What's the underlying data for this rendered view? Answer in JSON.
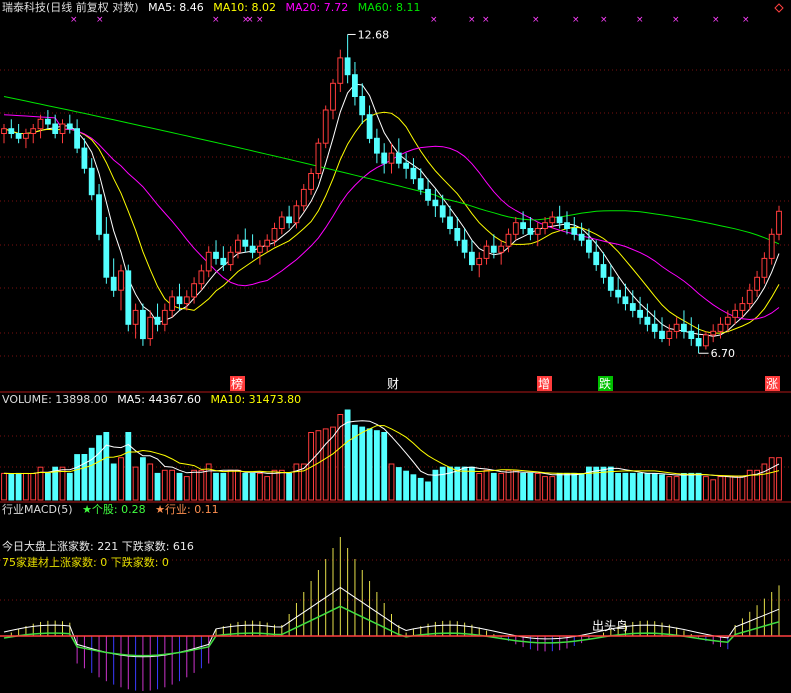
{
  "colors": {
    "up": "#ff3c3c",
    "down": "#54ffff",
    "ma5": "#ffffff",
    "ma10": "#ffff00",
    "ma20": "#ff00ff",
    "ma60": "#00e600",
    "grid": "#7a1010",
    "text": "#cccccc",
    "annotation": "#ffffff",
    "macd_pos": "#e6e04a",
    "macd_neg": "#cc33cc",
    "macd_neg_blue": "#3b3bff",
    "dif": "#ffffff",
    "dea": "#40dd40"
  },
  "header": {
    "title": "瑞泰科技(日线 前复权 对数)",
    "ma5": "MA5: 8.46",
    "ma10": "MA10: 8.02",
    "ma20": "MA20: 7.72",
    "ma60": "MA60: 8.11"
  },
  "volume_header": {
    "volume": "VOLUME: 13898.00",
    "ma5": "MA5: 44367.60",
    "ma10": "MA10: 31473.80"
  },
  "macd_header": {
    "title": "行业MACD(5)",
    "stock": "★个股: 0.28",
    "industry": "★行业: 0.11"
  },
  "info": {
    "market": "今日大盘上涨家数: 221 下跌家数: 616",
    "sector": "75家建材上涨家数: 0 下跌家数: 0"
  },
  "markers": [
    {
      "label": "榜",
      "bg": "#ff3c3c",
      "fg": "#ffffff",
      "x": 237
    },
    {
      "label": "财",
      "bg": "#000000",
      "fg": "#ffffff",
      "x": 393
    },
    {
      "label": "增",
      "bg": "#ff3c3c",
      "fg": "#ffffff",
      "x": 544
    },
    {
      "label": "跌",
      "bg": "#00c000",
      "fg": "#ffffff",
      "x": 605
    },
    {
      "label": "涨",
      "bg": "#ff3c3c",
      "fg": "#ffffff",
      "x": 772
    }
  ],
  "macd_label": "出头鸟",
  "chart_data": [
    {
      "type": "candlestick",
      "name": "price",
      "scale": "log",
      "ylim": [
        6.3,
        13.0
      ],
      "max_label": "12.68",
      "min_label": "6.70",
      "series": [
        {
          "name": "MA5",
          "label": "MA5: 8.46"
        },
        {
          "name": "MA10",
          "label": "MA10: 8.02"
        },
        {
          "name": "MA20",
          "label": "MA20: 7.72"
        },
        {
          "name": "MA60",
          "label": "MA60: 8.11"
        }
      ],
      "ohlc": [
        [
          10.4,
          10.6,
          10.2,
          10.5
        ],
        [
          10.5,
          10.7,
          10.3,
          10.4
        ],
        [
          10.4,
          10.6,
          10.2,
          10.3
        ],
        [
          10.3,
          10.5,
          10.1,
          10.4
        ],
        [
          10.4,
          10.6,
          10.2,
          10.5
        ],
        [
          10.5,
          10.8,
          10.3,
          10.7
        ],
        [
          10.7,
          10.9,
          10.5,
          10.6
        ],
        [
          10.6,
          10.8,
          10.3,
          10.4
        ],
        [
          10.4,
          10.7,
          10.2,
          10.6
        ],
        [
          10.6,
          10.8,
          10.4,
          10.5
        ],
        [
          10.5,
          10.7,
          10.0,
          10.1
        ],
        [
          10.1,
          10.3,
          9.6,
          9.7
        ],
        [
          9.7,
          9.9,
          9.1,
          9.2
        ],
        [
          9.2,
          9.4,
          8.4,
          8.5
        ],
        [
          8.5,
          8.8,
          7.7,
          7.8
        ],
        [
          7.8,
          8.1,
          7.5,
          7.6
        ],
        [
          7.6,
          8.0,
          7.3,
          7.9
        ],
        [
          7.9,
          8.0,
          7.0,
          7.1
        ],
        [
          7.1,
          7.4,
          6.9,
          7.3
        ],
        [
          7.3,
          7.4,
          6.8,
          6.9
        ],
        [
          6.9,
          7.3,
          6.8,
          7.2
        ],
        [
          7.2,
          7.4,
          7.0,
          7.1
        ],
        [
          7.1,
          7.4,
          7.0,
          7.3
        ],
        [
          7.3,
          7.6,
          7.2,
          7.5
        ],
        [
          7.5,
          7.7,
          7.3,
          7.4
        ],
        [
          7.4,
          7.6,
          7.3,
          7.5
        ],
        [
          7.5,
          7.8,
          7.4,
          7.7
        ],
        [
          7.7,
          8.0,
          7.6,
          7.9
        ],
        [
          7.9,
          8.3,
          7.8,
          8.2
        ],
        [
          8.2,
          8.4,
          8.0,
          8.1
        ],
        [
          8.1,
          8.3,
          7.9,
          8.0
        ],
        [
          8.0,
          8.3,
          7.9,
          8.2
        ],
        [
          8.2,
          8.5,
          8.1,
          8.4
        ],
        [
          8.4,
          8.6,
          8.2,
          8.3
        ],
        [
          8.3,
          8.5,
          8.1,
          8.2
        ],
        [
          8.2,
          8.4,
          8.0,
          8.3
        ],
        [
          8.3,
          8.5,
          8.2,
          8.4
        ],
        [
          8.4,
          8.7,
          8.3,
          8.6
        ],
        [
          8.6,
          8.9,
          8.5,
          8.8
        ],
        [
          8.8,
          9.0,
          8.6,
          8.7
        ],
        [
          8.7,
          9.1,
          8.6,
          9.0
        ],
        [
          9.0,
          9.4,
          8.9,
          9.3
        ],
        [
          9.3,
          9.7,
          9.2,
          9.6
        ],
        [
          9.6,
          10.3,
          9.5,
          10.2
        ],
        [
          10.2,
          11.0,
          10.1,
          10.9
        ],
        [
          10.9,
          11.6,
          10.7,
          11.5
        ],
        [
          11.5,
          12.3,
          11.3,
          12.1
        ],
        [
          12.1,
          12.68,
          11.5,
          11.7
        ],
        [
          11.7,
          12.0,
          11.0,
          11.2
        ],
        [
          11.2,
          11.5,
          10.6,
          10.8
        ],
        [
          10.8,
          11.0,
          10.2,
          10.3
        ],
        [
          10.3,
          10.5,
          9.8,
          10.0
        ],
        [
          10.0,
          10.2,
          9.6,
          9.8
        ],
        [
          9.8,
          10.2,
          9.6,
          10.0
        ],
        [
          10.0,
          10.3,
          9.7,
          9.8
        ],
        [
          9.8,
          10.0,
          9.5,
          9.7
        ],
        [
          9.7,
          9.9,
          9.4,
          9.5
        ],
        [
          9.5,
          9.7,
          9.2,
          9.3
        ],
        [
          9.3,
          9.5,
          9.0,
          9.1
        ],
        [
          9.1,
          9.3,
          8.8,
          9.0
        ],
        [
          9.0,
          9.2,
          8.7,
          8.8
        ],
        [
          8.8,
          9.0,
          8.5,
          8.6
        ],
        [
          8.6,
          8.8,
          8.3,
          8.4
        ],
        [
          8.4,
          8.6,
          8.1,
          8.2
        ],
        [
          8.2,
          8.4,
          7.9,
          8.0
        ],
        [
          8.0,
          8.2,
          7.8,
          8.1
        ],
        [
          8.1,
          8.4,
          8.0,
          8.3
        ],
        [
          8.3,
          8.5,
          8.1,
          8.2
        ],
        [
          8.2,
          8.4,
          8.0,
          8.3
        ],
        [
          8.3,
          8.6,
          8.2,
          8.5
        ],
        [
          8.5,
          8.8,
          8.4,
          8.7
        ],
        [
          8.7,
          8.9,
          8.5,
          8.6
        ],
        [
          8.6,
          8.8,
          8.4,
          8.5
        ],
        [
          8.5,
          8.7,
          8.3,
          8.6
        ],
        [
          8.6,
          8.8,
          8.5,
          8.7
        ],
        [
          8.7,
          8.9,
          8.6,
          8.8
        ],
        [
          8.8,
          9.0,
          8.6,
          8.7
        ],
        [
          8.7,
          8.9,
          8.5,
          8.6
        ],
        [
          8.6,
          8.8,
          8.4,
          8.5
        ],
        [
          8.5,
          8.7,
          8.3,
          8.4
        ],
        [
          8.4,
          8.6,
          8.1,
          8.2
        ],
        [
          8.2,
          8.4,
          7.9,
          8.0
        ],
        [
          8.0,
          8.2,
          7.7,
          7.8
        ],
        [
          7.8,
          8.0,
          7.5,
          7.6
        ],
        [
          7.6,
          7.8,
          7.4,
          7.5
        ],
        [
          7.5,
          7.7,
          7.3,
          7.4
        ],
        [
          7.4,
          7.6,
          7.2,
          7.3
        ],
        [
          7.3,
          7.5,
          7.1,
          7.2
        ],
        [
          7.2,
          7.4,
          7.0,
          7.1
        ],
        [
          7.1,
          7.3,
          6.9,
          7.0
        ],
        [
          7.0,
          7.2,
          6.85,
          6.9
        ],
        [
          6.9,
          7.1,
          6.8,
          7.0
        ],
        [
          7.0,
          7.2,
          6.9,
          7.1
        ],
        [
          7.1,
          7.3,
          6.9,
          7.0
        ],
        [
          7.0,
          7.2,
          6.8,
          6.9
        ],
        [
          6.9,
          7.1,
          6.7,
          6.8
        ],
        [
          6.8,
          7.0,
          6.75,
          6.95
        ],
        [
          6.95,
          7.1,
          6.85,
          7.0
        ],
        [
          7.0,
          7.2,
          6.9,
          7.1
        ],
        [
          7.1,
          7.3,
          7.0,
          7.2
        ],
        [
          7.2,
          7.4,
          7.1,
          7.3
        ],
        [
          7.3,
          7.5,
          7.2,
          7.4
        ],
        [
          7.4,
          7.7,
          7.3,
          7.6
        ],
        [
          7.6,
          7.9,
          7.5,
          7.8
        ],
        [
          7.8,
          8.2,
          7.7,
          8.1
        ],
        [
          8.1,
          8.6,
          8.0,
          8.5
        ],
        [
          8.5,
          9.0,
          8.4,
          8.9
        ]
      ]
    },
    {
      "type": "bar",
      "name": "volume",
      "series": [
        {
          "name": "VOLUME",
          "label": "VOLUME: 13898.00"
        },
        {
          "name": "MA5",
          "label": "MA5: 44367.60"
        },
        {
          "name": "MA10",
          "label": "MA10: 31473.80"
        }
      ]
    },
    {
      "type": "bar",
      "name": "macd",
      "series": [
        {
          "name": "个股",
          "label": "★个股: 0.28"
        },
        {
          "name": "行业",
          "label": "★行业: 0.11"
        }
      ]
    }
  ]
}
